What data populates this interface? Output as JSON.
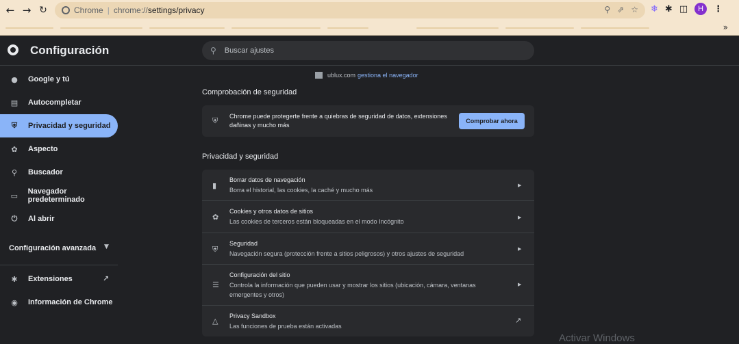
{
  "browser": {
    "back_icon": "arrow-left-icon",
    "forward_icon": "arrow-right-icon",
    "reload_icon": "reload-icon",
    "omnibox_site_label": "Chrome",
    "omnibox_scheme": "chrome://",
    "omnibox_path": "settings/privacy",
    "profile_initial": "H",
    "profile_color": "#8430ce"
  },
  "settings": {
    "title": "Configuración",
    "search_placeholder": "Buscar ajustes"
  },
  "sidebar": {
    "items": [
      {
        "label": "Google y tú",
        "icon": "person-icon"
      },
      {
        "label": "Autocompletar",
        "icon": "clipboard-icon"
      },
      {
        "label": "Privacidad y seguridad",
        "icon": "shield-icon"
      },
      {
        "label": "Aspecto",
        "icon": "palette-icon"
      },
      {
        "label": "Buscador",
        "icon": "search-icon"
      },
      {
        "label": "Navegador predeterminado",
        "icon": "browser-icon"
      },
      {
        "label": "Al abrir",
        "icon": "power-icon"
      }
    ],
    "advanced_label": "Configuración avanzada",
    "extensions_label": "Extensiones",
    "about_label": "Información de Chrome"
  },
  "main": {
    "managed_domain": "ublux.com",
    "managed_link": "gestiona el navegador",
    "safety_check_title": "Comprobación de seguridad",
    "safety_check_text": "Chrome puede protegerte frente a quiebras de seguridad de datos, extensiones dañinas y mucho más",
    "safety_check_button": "Comprobar ahora",
    "privacy_title": "Privacidad y seguridad",
    "rows": [
      {
        "title": "Borrar datos de navegación",
        "desc": "Borra el historial, las cookies, la caché y mucho más"
      },
      {
        "title": "Cookies y otros datos de sitios",
        "desc": "Las cookies de terceros están bloqueadas en el modo Incógnito"
      },
      {
        "title": "Seguridad",
        "desc": "Navegación segura (protección frente a sitios peligrosos) y otros ajustes de seguridad"
      },
      {
        "title": "Configuración del sitio",
        "desc": "Controla la información que pueden usar y mostrar los sitios (ubicación, cámara, ventanas emergentes y otros)"
      },
      {
        "title": "Privacy Sandbox",
        "desc": "Las funciones de prueba están activadas"
      }
    ]
  },
  "watermark": "Activar Windows",
  "accent": "#8ab4f8"
}
